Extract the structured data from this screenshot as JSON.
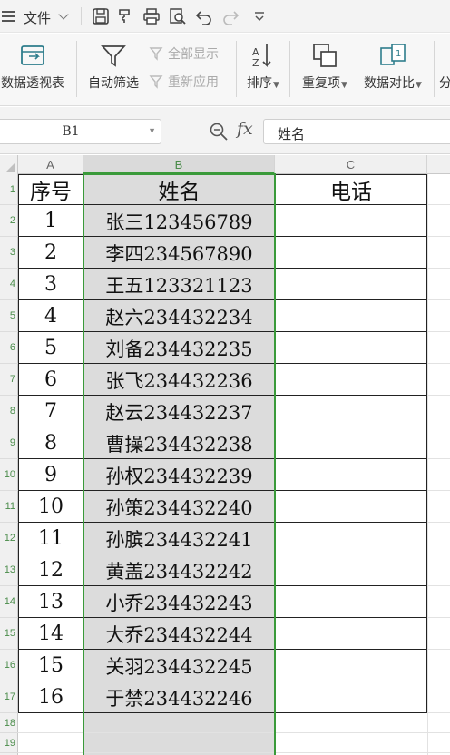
{
  "menubar": {
    "file_label": "文件"
  },
  "ribbon": {
    "pivot_label": "数据透视表",
    "autofilter_label": "自动筛选",
    "show_all_label": "全部显示",
    "reapply_label": "重新应用",
    "sort_label": "排序",
    "duplicates_label": "重复项",
    "compare_label": "数据对比",
    "more_label": "分"
  },
  "formula_bar": {
    "name_box": "B1",
    "fx_label": "fx",
    "formula": "姓名"
  },
  "sheet": {
    "columns": [
      "A",
      "B",
      "C"
    ],
    "row_numbers": [
      "1",
      "2",
      "3",
      "4",
      "5",
      "6",
      "7",
      "8",
      "9",
      "10",
      "11",
      "12",
      "13",
      "14",
      "15",
      "16",
      "17",
      "18",
      "19"
    ],
    "header": {
      "a": "序号",
      "b": "姓名",
      "c": "电话"
    },
    "rows": [
      {
        "a": "1",
        "b": "张三123456789"
      },
      {
        "a": "2",
        "b": "李四234567890"
      },
      {
        "a": "3",
        "b": "王五123321123"
      },
      {
        "a": "4",
        "b": "赵六234432234"
      },
      {
        "a": "5",
        "b": "刘备234432235"
      },
      {
        "a": "6",
        "b": "张飞234432236"
      },
      {
        "a": "7",
        "b": "赵云234432237"
      },
      {
        "a": "8",
        "b": "曹操234432238"
      },
      {
        "a": "9",
        "b": "孙权234432239"
      },
      {
        "a": "10",
        "b": "孙策234432240"
      },
      {
        "a": "11",
        "b": "孙膑234432241"
      },
      {
        "a": "12",
        "b": "黄盖234432242"
      },
      {
        "a": "13",
        "b": "小乔234432243"
      },
      {
        "a": "14",
        "b": "大乔234432244"
      },
      {
        "a": "15",
        "b": "关羽234432245"
      },
      {
        "a": "16",
        "b": "于禁234432246"
      }
    ]
  },
  "colors": {
    "selection": "#3a9a3a",
    "selected_column_fill": "#dcdcdc"
  }
}
